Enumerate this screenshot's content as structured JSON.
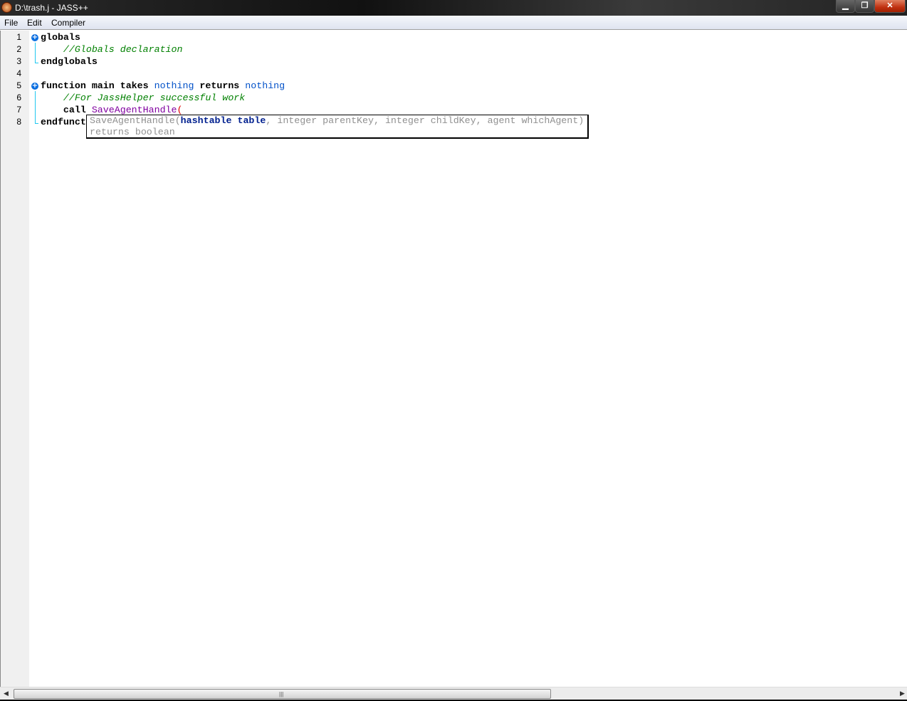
{
  "window": {
    "title": "D:\\trash.j - JASS++",
    "minimize": "▁",
    "maximize": "❐",
    "close": "✕"
  },
  "menu": [
    "File",
    "Edit",
    "Compiler"
  ],
  "lines": [
    {
      "n": "1",
      "parts": [
        [
          "kw",
          "globals"
        ]
      ]
    },
    {
      "n": "2",
      "parts": [
        [
          "",
          "    "
        ],
        [
          "cm",
          "//Globals declaration"
        ]
      ]
    },
    {
      "n": "3",
      "parts": [
        [
          "kw",
          "endglobals"
        ]
      ]
    },
    {
      "n": "4",
      "parts": []
    },
    {
      "n": "5",
      "parts": [
        [
          "kw",
          "function main takes "
        ],
        [
          "ty",
          "nothing"
        ],
        [
          "kw",
          " returns "
        ],
        [
          "ty",
          "nothing"
        ]
      ]
    },
    {
      "n": "6",
      "parts": [
        [
          "",
          "    "
        ],
        [
          "cm",
          "//For JassHelper successful work"
        ]
      ]
    },
    {
      "n": "7",
      "parts": [
        [
          "kw",
          "    call "
        ],
        [
          "fn",
          "SaveAgentHandle"
        ],
        [
          "par",
          "("
        ]
      ]
    },
    {
      "n": "8",
      "parts": [
        [
          "kw",
          "endfunction"
        ]
      ]
    }
  ],
  "tooltip": {
    "name": "SaveAgentHandle(",
    "current_param": "hashtable table",
    "rest": ", integer parentKey, integer childKey, agent whichAgent)",
    "returns": "returns boolean"
  },
  "scrollbar": {
    "grip": "|||",
    "left": "◀",
    "right": "▶"
  }
}
